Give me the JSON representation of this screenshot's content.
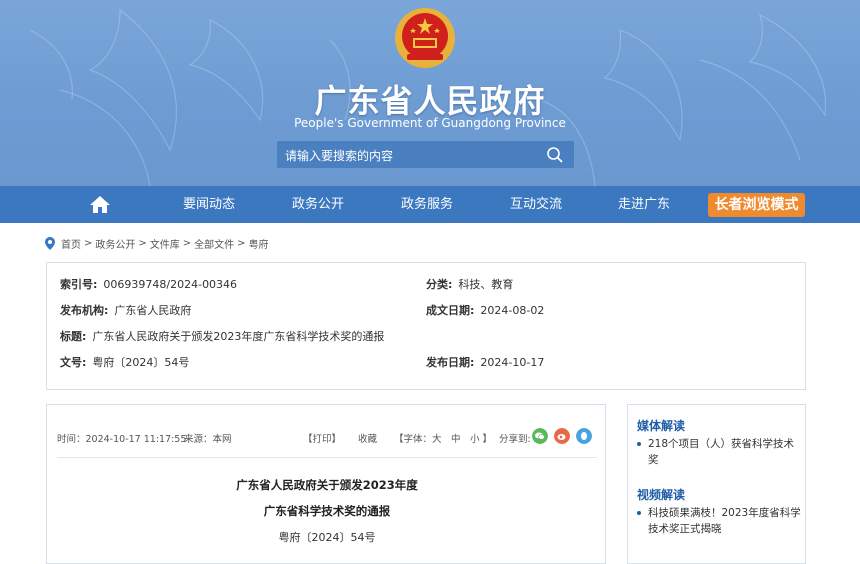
{
  "header": {
    "title": "广东省人民政府",
    "subtitle": "People's Government of Guangdong Province",
    "search_placeholder": "请输入要搜索的内容"
  },
  "nav": {
    "items": [
      "要闻动态",
      "政务公开",
      "政务服务",
      "互动交流",
      "走进广东"
    ],
    "elder_mode": "长者浏览模式"
  },
  "breadcrumb": [
    "首页",
    ">",
    "政务公开",
    ">",
    "文件库",
    ">",
    "全部文件",
    ">",
    "粤府"
  ],
  "meta": {
    "index_label": "索引号:",
    "index_value": "006939748/2024-00346",
    "category_label": "分类:",
    "category_value": "科技、教育",
    "issuer_label": "发布机构:",
    "issuer_value": "广东省人民政府",
    "created_label": "成文日期:",
    "created_value": "2024-08-02",
    "title_label": "标题:",
    "title_value": "广东省人民政府关于颁发2023年度广东省科学技术奖的通报",
    "docno_label": "文号:",
    "docno_value": "粤府〔2024〕54号",
    "published_label": "发布日期:",
    "published_value": "2024-10-17"
  },
  "article": {
    "time": "时间：2024-10-17 11:17:55",
    "source": "来源：本网",
    "print": "【打印】",
    "favorite": "收藏",
    "font_size": "【字体：大　中　小 】",
    "share": "分享到:",
    "title_line1": "广东省人民政府关于颁发2023年度",
    "title_line2": "广东省科学技术奖的通报",
    "doc_no": "粤府〔2024〕54号"
  },
  "sidebar": {
    "media_heading": "媒体解读",
    "media_item": "218个项目（人）获省科学技术奖",
    "video_heading": "视频解读",
    "video_item": "科技硕果满枝！2023年度省科学技术奖正式揭晓"
  },
  "colors": {
    "banner": "#6d9bd2",
    "nav": "#3b78c0",
    "elder_button": "#f08a2e",
    "heading_blue": "#1f5ea8"
  }
}
